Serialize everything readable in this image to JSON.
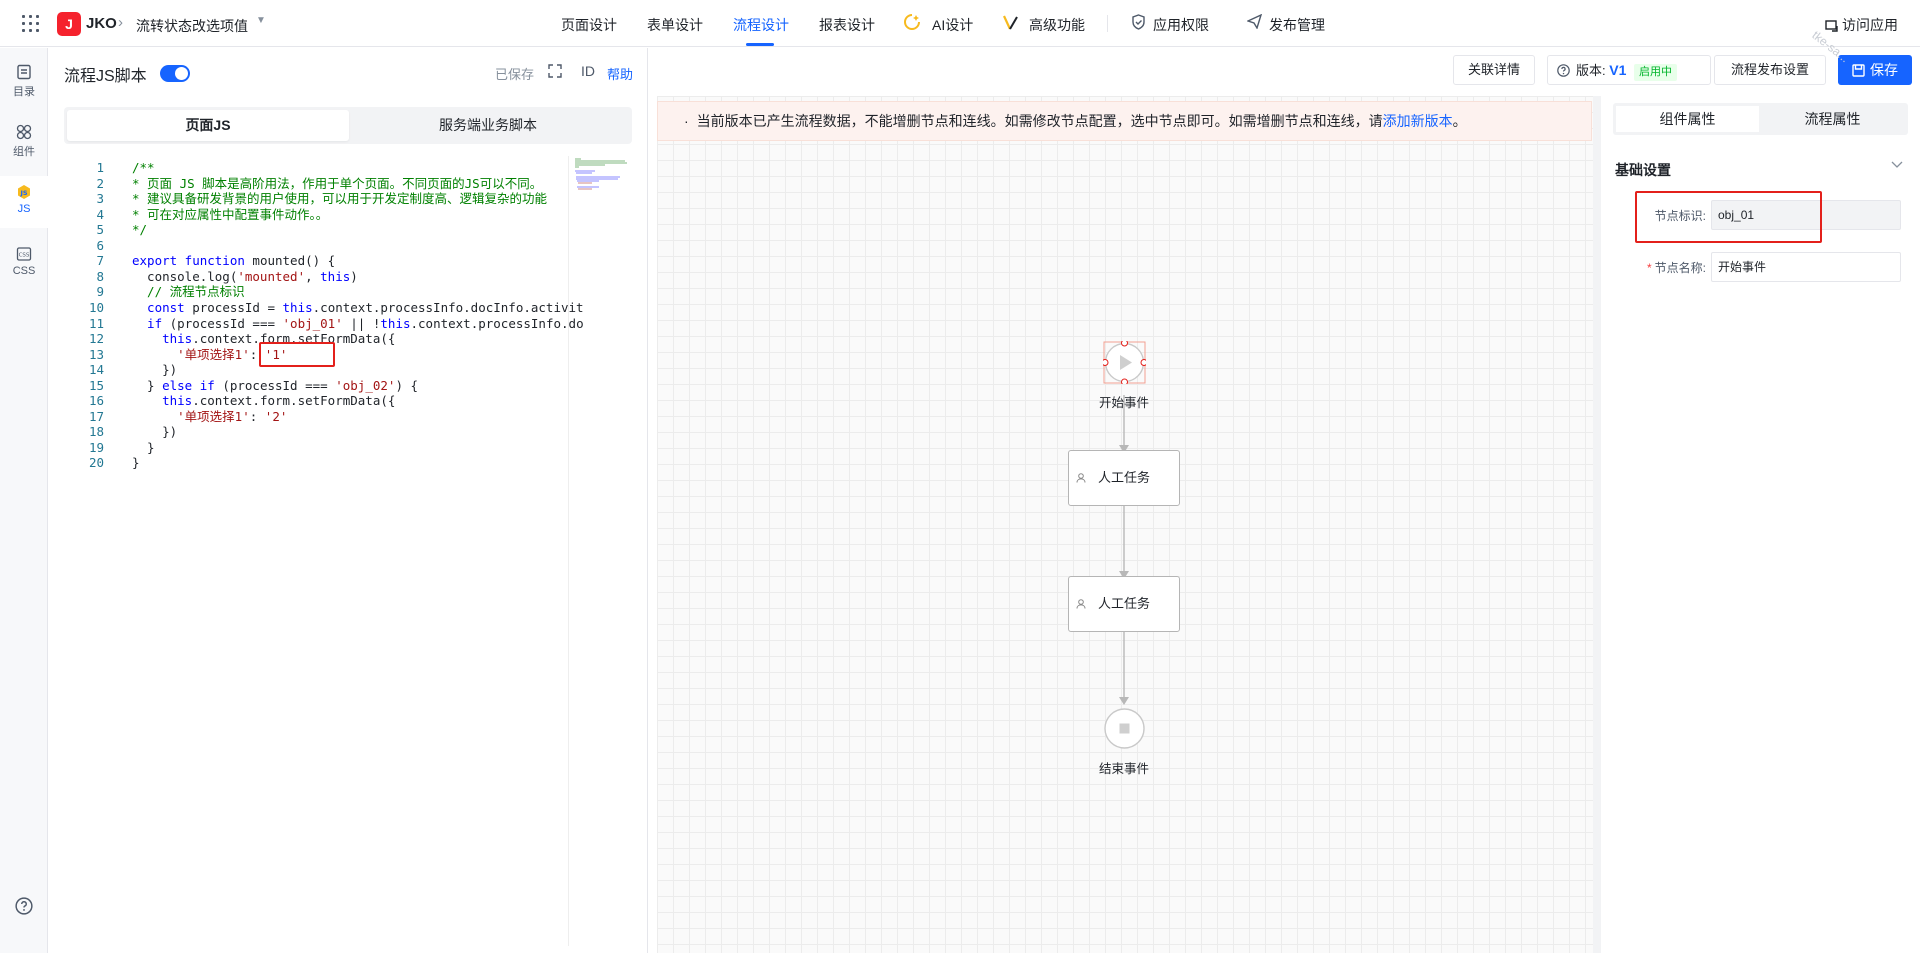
{
  "app": {
    "logo_letter": "J",
    "name": "JKO",
    "breadcrumb": "流转状态改选项值"
  },
  "nav": {
    "items": [
      "页面设计",
      "表单设计",
      "流程设计",
      "报表设计",
      "AI设计",
      "高级功能",
      "应用权限",
      "发布管理"
    ],
    "active": "流程设计",
    "visit": "访问应用"
  },
  "leftbar": {
    "items": [
      "目录",
      "组件",
      "JS",
      "CSS"
    ],
    "active": "JS"
  },
  "js_panel": {
    "title": "流程JS脚本",
    "enabled": true,
    "saved": "已保存",
    "id_label": "ID",
    "help": "帮助",
    "tabs": [
      "页面JS",
      "服务端业务脚本"
    ],
    "active_tab": "页面JS",
    "code": [
      {
        "n": "1",
        "parts": [
          {
            "c": "cm",
            "t": "/**"
          }
        ]
      },
      {
        "n": "2",
        "parts": [
          {
            "c": "cm",
            "t": "* 页面 JS 脚本是高阶用法，作用于单个页面。不同页面的JS可以不同。"
          }
        ]
      },
      {
        "n": "3",
        "parts": [
          {
            "c": "cm",
            "t": "* 建议具备研发背景的用户使用，可以用于开发定制度高、逻辑复杂的功能"
          }
        ]
      },
      {
        "n": "4",
        "parts": [
          {
            "c": "cm",
            "t": "* 可在对应属性中配置事件动作。。"
          }
        ]
      },
      {
        "n": "5",
        "parts": [
          {
            "c": "cm",
            "t": "*/"
          }
        ]
      },
      {
        "n": "6",
        "parts": []
      },
      {
        "n": "7",
        "parts": [
          {
            "c": "kw",
            "t": "export function "
          },
          {
            "c": "pl",
            "t": "mounted() {"
          }
        ]
      },
      {
        "n": "8",
        "parts": [
          {
            "c": "pl",
            "t": "  console.log("
          },
          {
            "c": "st",
            "t": "'mounted'"
          },
          {
            "c": "pl",
            "t": ", "
          },
          {
            "c": "kw",
            "t": "this"
          },
          {
            "c": "pl",
            "t": ")"
          }
        ]
      },
      {
        "n": "9",
        "parts": [
          {
            "c": "cm",
            "t": "  // 流程节点标识"
          }
        ]
      },
      {
        "n": "10",
        "parts": [
          {
            "c": "kw",
            "t": "  const "
          },
          {
            "c": "pl",
            "t": "processId = "
          },
          {
            "c": "kw",
            "t": "this"
          },
          {
            "c": "pl",
            "t": ".context.processInfo.docInfo.activit"
          }
        ]
      },
      {
        "n": "11",
        "parts": [
          {
            "c": "kw",
            "t": "  if "
          },
          {
            "c": "pl",
            "t": "(processId === "
          },
          {
            "c": "st",
            "t": "'obj_01'"
          },
          {
            "c": "pl",
            "t": " || !"
          },
          {
            "c": "kw",
            "t": "this"
          },
          {
            "c": "pl",
            "t": ".context.processInfo.do"
          }
        ]
      },
      {
        "n": "12",
        "parts": [
          {
            "c": "kw",
            "t": "    this"
          },
          {
            "c": "pl",
            "t": ".context.form.setFormData({"
          }
        ]
      },
      {
        "n": "13",
        "parts": [
          {
            "c": "st",
            "t": "      '单项选择1'"
          },
          {
            "c": "pl",
            "t": ": "
          },
          {
            "c": "st",
            "t": "'1'"
          }
        ]
      },
      {
        "n": "14",
        "parts": [
          {
            "c": "pl",
            "t": "    })"
          }
        ]
      },
      {
        "n": "15",
        "parts": [
          {
            "c": "pl",
            "t": "  } "
          },
          {
            "c": "kw",
            "t": "else if "
          },
          {
            "c": "pl",
            "t": "(processId === "
          },
          {
            "c": "st",
            "t": "'obj_02'"
          },
          {
            "c": "pl",
            "t": ") {"
          }
        ]
      },
      {
        "n": "16",
        "parts": [
          {
            "c": "kw",
            "t": "    this"
          },
          {
            "c": "pl",
            "t": ".context.form.setFormData({"
          }
        ]
      },
      {
        "n": "17",
        "parts": [
          {
            "c": "st",
            "t": "      '单项选择1'"
          },
          {
            "c": "pl",
            "t": ": "
          },
          {
            "c": "st",
            "t": "'2'"
          }
        ]
      },
      {
        "n": "18",
        "parts": [
          {
            "c": "pl",
            "t": "    })"
          }
        ]
      },
      {
        "n": "19",
        "parts": [
          {
            "c": "pl",
            "t": "  }"
          }
        ]
      },
      {
        "n": "20",
        "parts": [
          {
            "c": "pl",
            "t": "}"
          }
        ]
      }
    ]
  },
  "toolbar": {
    "related": "关联详情",
    "version_label": "版本:",
    "version_value": "V1",
    "version_status": "启用中",
    "publish_settings": "流程发布设置",
    "save": "保存"
  },
  "banner": {
    "text": "当前版本已产生流程数据，不能增删节点和连线。如需修改节点配置，选中节点即可。如需增删节点和连线，请",
    "link": "添加新版本",
    "tail": "。"
  },
  "flow": {
    "start_label": "开始事件",
    "task1_label": "人工任务",
    "task2_label": "人工任务",
    "end_label": "结束事件"
  },
  "props": {
    "tabs": [
      "组件属性",
      "流程属性"
    ],
    "active_tab": "组件属性",
    "section_title": "基础设置",
    "node_id_label": "节点标识:",
    "node_id_value": "obj_01",
    "node_name_label": "节点名称:",
    "node_name_value": "开始事件"
  },
  "watermark": "tke-sa..."
}
